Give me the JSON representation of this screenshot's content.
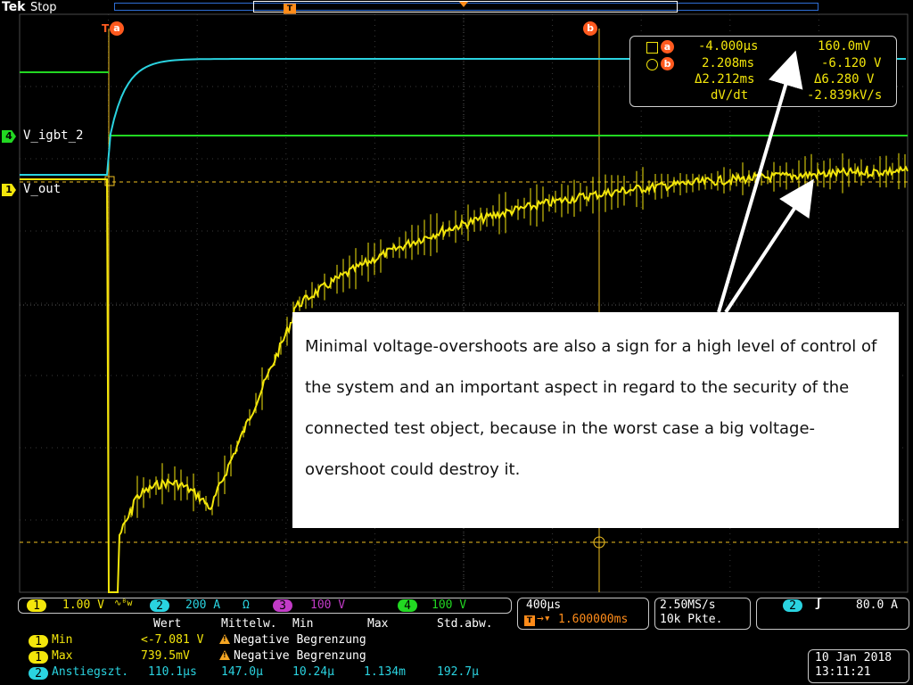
{
  "top": {
    "brand": "Tek",
    "state": "Stop",
    "trigger_marker": "T"
  },
  "cursors": {
    "a_tag": "a",
    "b_tag": "b"
  },
  "channels": [
    {
      "id": "4",
      "label": "V_igbt_2",
      "color": "#22d822"
    },
    {
      "id": "1",
      "label": "V_out",
      "color": "#f3e60b"
    }
  ],
  "readout": {
    "row1": {
      "time": "-4.000µs",
      "volt": "160.0mV"
    },
    "row2": {
      "time": "2.208ms",
      "volt": "-6.120 V"
    },
    "row3": {
      "time": "Δ2.212ms",
      "volt": "Δ6.280 V"
    },
    "row4": {
      "label": "dV/dt",
      "volt": "-2.839kV/s"
    }
  },
  "annotation": "Minimal voltage-overshoots are also a sign for a high level of control of the system and an important aspect in regard to the security of the connected test object, because in the worst case a big voltage-overshoot could destroy it.",
  "bottom": {
    "ch1": {
      "id": "1",
      "scale": "1.00 V",
      "extra": "∿ᴮw"
    },
    "ch2": {
      "id": "2",
      "scale": "200 A",
      "extra": "Ω"
    },
    "ch3": {
      "id": "3",
      "scale": "100 V"
    },
    "ch4": {
      "id": "4",
      "scale": "100 V"
    },
    "measure_header": {
      "wert": "Wert",
      "mean": "Mittelw.",
      "min": "Min",
      "max": "Max",
      "std": "Std.abw."
    },
    "measures": [
      {
        "ch": "1",
        "name": "Min",
        "wert": "<-7.081 V",
        "note": "Negative Begrenzung"
      },
      {
        "ch": "1",
        "name": "Max",
        "wert": "739.5mV",
        "note": "Negative Begrenzung"
      },
      {
        "ch": "2",
        "name": "Anstiegszt.",
        "wert": "110.1µs",
        "mean": "147.0µ",
        "min": "10.24µ",
        "max": "1.134m",
        "std": "192.7µ"
      }
    ],
    "horizontal": {
      "scale": "400µs",
      "delay": "1.600000ms"
    },
    "acq": {
      "rate": "2.50MS/s",
      "points": "10k Pkte."
    },
    "trigger": {
      "ch": "2",
      "level": "80.0 A"
    },
    "datetime": {
      "date": "10 Jan  2018",
      "time": "13:11:21"
    }
  },
  "colors": {
    "ch1": "#f3e60b",
    "ch2": "#2ad3e0",
    "ch3": "#c23bc7",
    "ch4": "#22d822",
    "cursor": "#f0c020",
    "accent": "#ff5a1f"
  }
}
